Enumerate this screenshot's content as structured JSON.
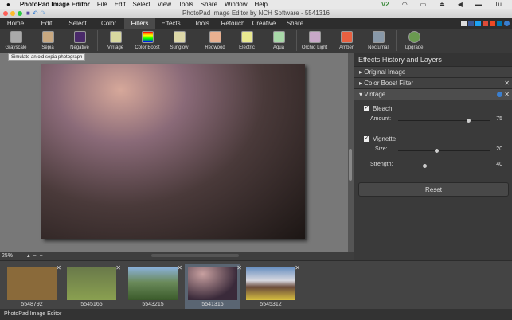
{
  "menubar": {
    "app": "PhotoPad Image Editor",
    "items": [
      "File",
      "Edit",
      "Select",
      "View",
      "Tools",
      "Share",
      "Window",
      "Help"
    ],
    "right": [
      "V2",
      "Tu"
    ]
  },
  "window": {
    "title": "PhotoPad Image Editor by NCH Software - 5541316"
  },
  "tabs": [
    "Home",
    "Edit",
    "Select",
    "Color",
    "Filters",
    "Effects",
    "Tools",
    "Retouch",
    "Creative",
    "Share"
  ],
  "toolbar": [
    "Grayscale",
    "Sepia",
    "Negative",
    "Vintage",
    "Color Boost",
    "Sunglow",
    "Redwood",
    "Electric",
    "Aqua",
    "Orchid Light",
    "Amber",
    "Nocturnal",
    "Upgrade"
  ],
  "tooltip": "Simulate an old sepia photograph",
  "zoom": {
    "level": "25%",
    "minus": "−",
    "plus": "+"
  },
  "panel": {
    "title": "Effects History and Layers",
    "layers": [
      "Original Image",
      "Color Boost Filter",
      "Vintage"
    ],
    "bleach": {
      "label": "Bleach",
      "amount_label": "Amount:",
      "amount": "75"
    },
    "vignette": {
      "label": "Vignette",
      "size_label": "Size:",
      "size": "20",
      "strength_label": "Strength:",
      "strength": "40"
    },
    "reset": "Reset"
  },
  "slider_fractions": {
    "amount": 0.75,
    "size": 0.4,
    "strength": 0.27
  },
  "thumbnails": [
    "5548792",
    "5545165",
    "5543215",
    "5541316",
    "5545312"
  ],
  "status": "PhotoPad Image Editor"
}
